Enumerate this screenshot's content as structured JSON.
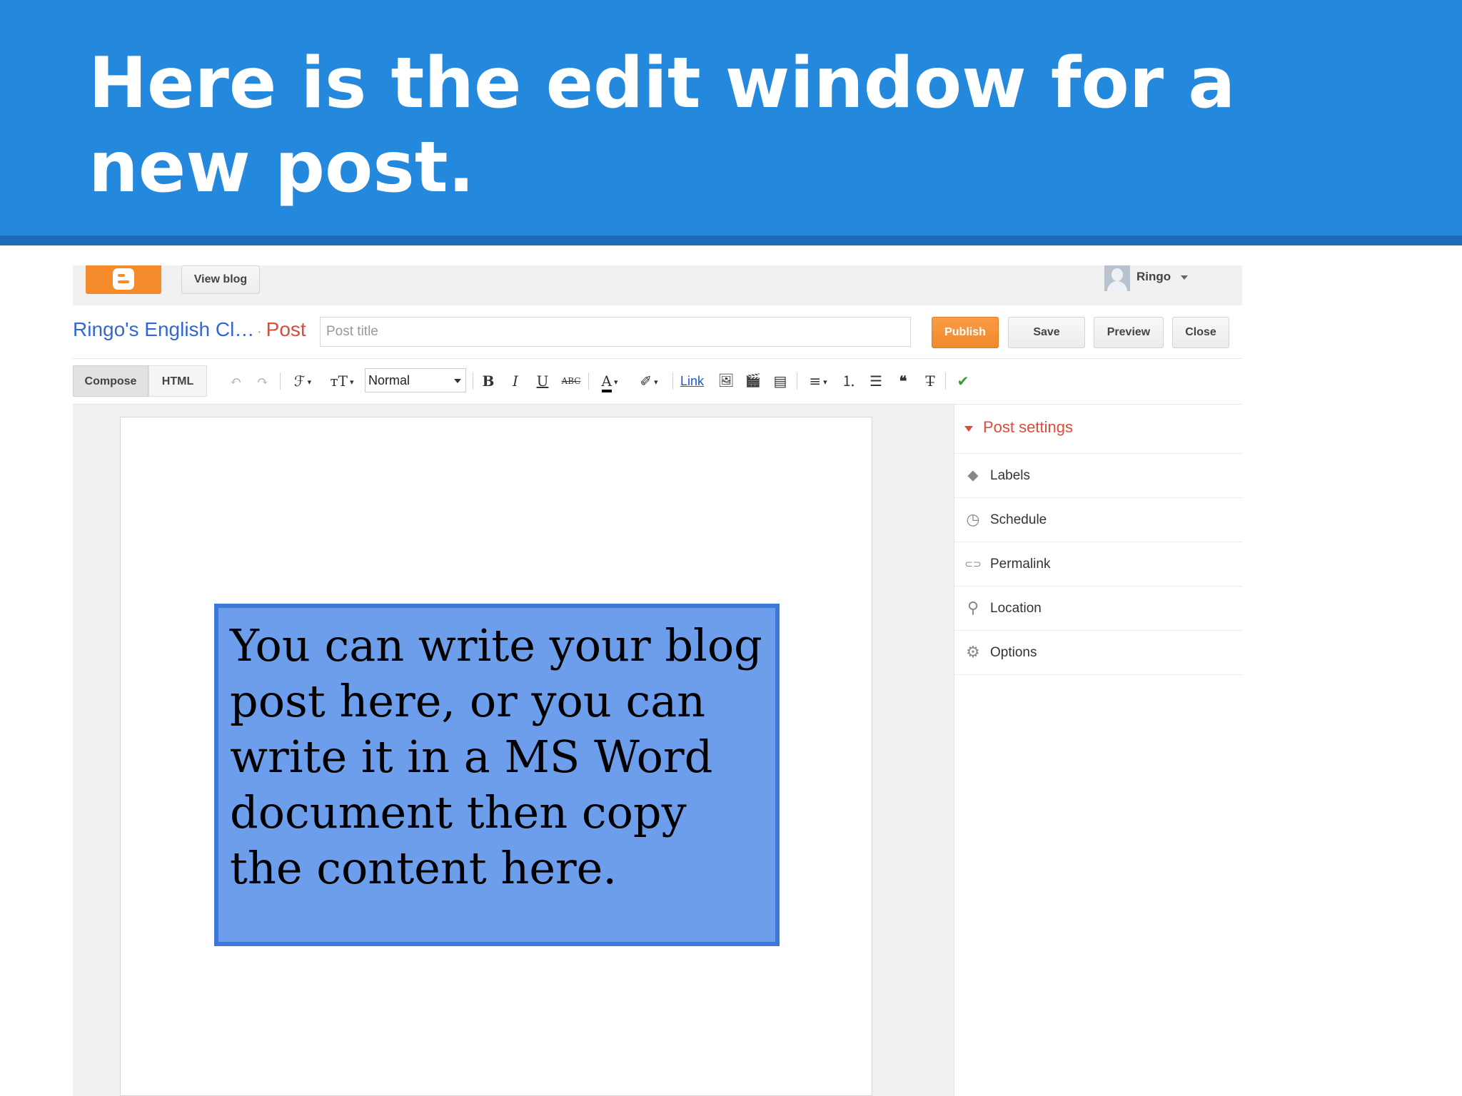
{
  "slide": {
    "title": "Here is the edit window for a new post."
  },
  "topbar": {
    "view_blog": "View blog",
    "user_name": "Ringo"
  },
  "header": {
    "blog_name": "Ringo's English Cl…",
    "post_separator": "·",
    "post_label": "Post",
    "title_placeholder": "Post title",
    "title_value": "",
    "publish": "Publish",
    "save": "Save",
    "preview": "Preview",
    "close": "Close"
  },
  "editor_tabs": {
    "compose": "Compose",
    "html": "HTML"
  },
  "toolbar": {
    "undo": "↶",
    "redo": "↷",
    "font": "ℱ",
    "font_size": "тT",
    "caret": "▾",
    "format_selected": "Normal",
    "bold": "B",
    "italic": "I",
    "underline": "U",
    "strikethrough": "ABC",
    "text_color": "A",
    "highlight": "✐",
    "link": "Link",
    "image": "🖼",
    "video": "🎬",
    "jump_break": "▤",
    "align": "≡",
    "numbered_list": "⒈",
    "bullet_list": "☰",
    "quote": "❝",
    "clear_format": "T̶",
    "spellcheck": "✔"
  },
  "body": {
    "note": "You can write your blog post here, or you can write it in a MS Word document then copy the content here."
  },
  "sidebar": {
    "header": "Post settings",
    "items": [
      {
        "label": "Labels",
        "icon": "label-tag-icon",
        "glyph": "⬥"
      },
      {
        "label": "Schedule",
        "icon": "clock-icon",
        "glyph": "◷"
      },
      {
        "label": "Permalink",
        "icon": "link-icon",
        "glyph": "⊂⊃"
      },
      {
        "label": "Location",
        "icon": "location-pin-icon",
        "glyph": "⚲"
      },
      {
        "label": "Options",
        "icon": "gear-icon",
        "glyph": "⚙"
      }
    ]
  },
  "colors": {
    "banner": "#2489dd",
    "accent_orange": "#f68b2c",
    "link_blue": "#3367d6",
    "post_red": "#dd4b39",
    "note_fill": "#6d9eeb",
    "note_border": "#3c78d8"
  }
}
